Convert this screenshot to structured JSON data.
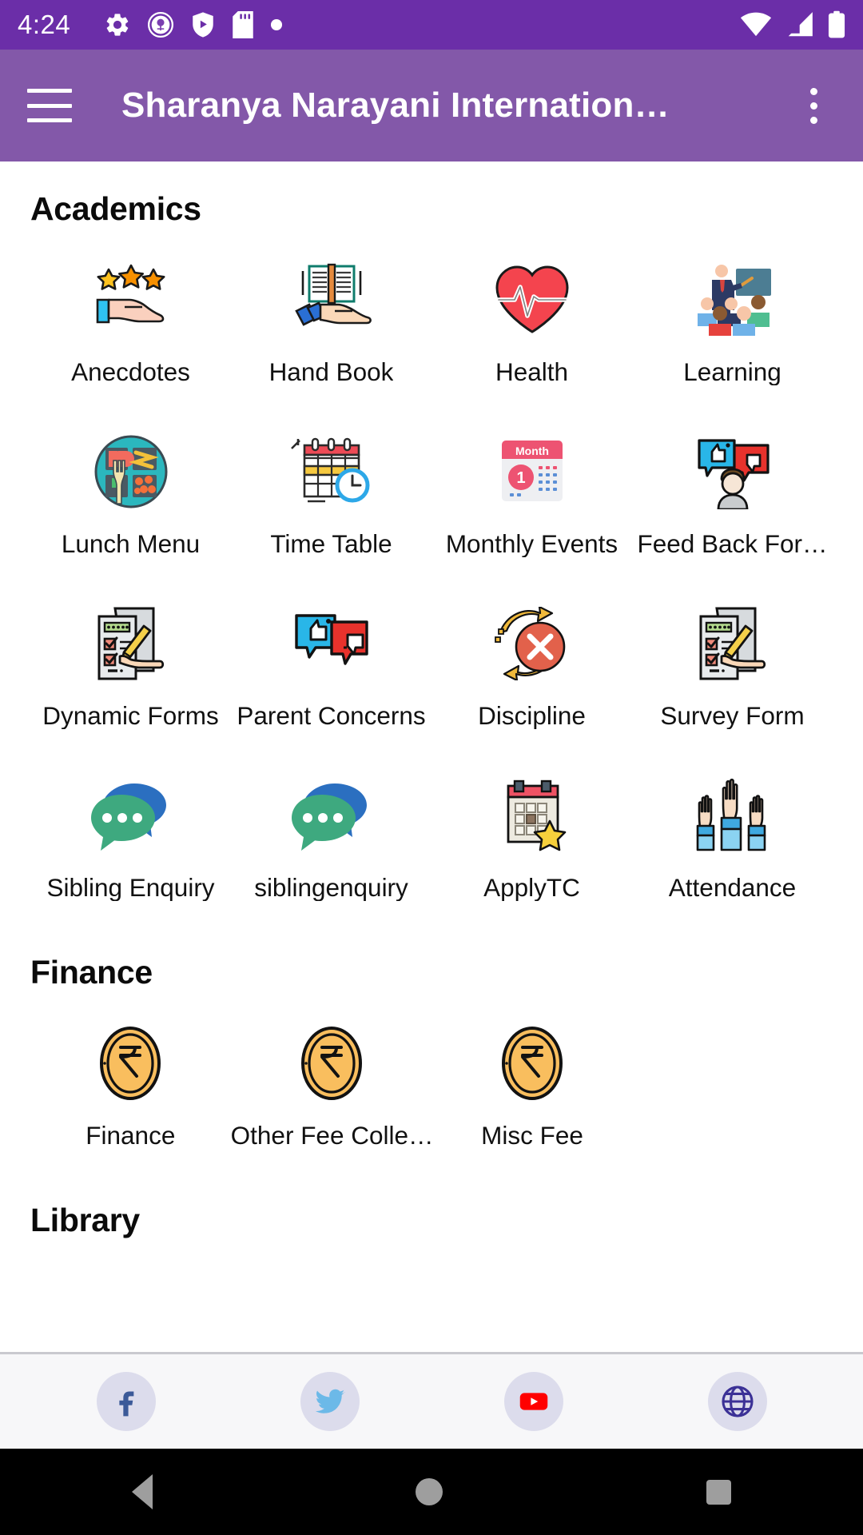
{
  "statusbar": {
    "time": "4:24",
    "left_icons": [
      "gear-icon",
      "school-badge-icon",
      "shield-play-icon",
      "sd-card-icon",
      "dot-icon"
    ],
    "right_icons": [
      "wifi-icon",
      "cellular-signal-icon",
      "battery-icon"
    ],
    "background": "#6B2EA8"
  },
  "appbar": {
    "title": "Sharanya Narayani Internation…",
    "menu_icon": "hamburger-menu-icon",
    "overflow_icon": "overflow-menu-icon",
    "background": "#8358A9"
  },
  "sections": [
    {
      "title": "Academics",
      "items": [
        {
          "label": "Anecdotes",
          "icon": "stars-on-hand-icon"
        },
        {
          "label": "Hand Book",
          "icon": "open-book-on-hand-icon"
        },
        {
          "label": "Health",
          "icon": "heart-pulse-icon"
        },
        {
          "label": "Learning",
          "icon": "classroom-teaching-icon"
        },
        {
          "label": "Lunch Menu",
          "icon": "food-tray-icon"
        },
        {
          "label": "Time Table",
          "icon": "calendar-clock-icon"
        },
        {
          "label": "Monthly Events",
          "icon": "month-calendar-icon"
        },
        {
          "label": "Feed Back For…",
          "icon": "feedback-person-icon"
        },
        {
          "label": "Dynamic Forms",
          "icon": "checklist-pencil-icon"
        },
        {
          "label": "Parent Concerns",
          "icon": "thumbs-chat-icon"
        },
        {
          "label": "Discipline",
          "icon": "red-x-refresh-icon"
        },
        {
          "label": "Survey Form",
          "icon": "checklist-pencil-icon"
        },
        {
          "label": "Sibling Enquiry",
          "icon": "chat-bubbles-icon"
        },
        {
          "label": "siblingenquiry",
          "icon": "chat-bubbles-icon"
        },
        {
          "label": "ApplyTC",
          "icon": "calendar-star-icon"
        },
        {
          "label": "Attendance",
          "icon": "raised-hands-icon"
        }
      ]
    },
    {
      "title": "Finance",
      "items": [
        {
          "label": "Finance",
          "icon": "rupee-coin-icon"
        },
        {
          "label": "Other Fee Colle…",
          "icon": "rupee-coin-icon"
        },
        {
          "label": "Misc Fee",
          "icon": "rupee-coin-icon"
        }
      ]
    },
    {
      "title": "Library",
      "items": []
    }
  ],
  "social": [
    {
      "name": "facebook",
      "label": "f"
    },
    {
      "name": "twitter",
      "label": ""
    },
    {
      "name": "youtube",
      "label": ""
    },
    {
      "name": "website",
      "label": ""
    }
  ],
  "navbar": {
    "back": "back-icon",
    "home": "home-icon",
    "recents": "recents-icon"
  },
  "colors": {
    "status": "#6B2EA8",
    "appbar": "#8358A9",
    "accent": "#6B2EA8",
    "social_bg": "#dcdcec"
  }
}
